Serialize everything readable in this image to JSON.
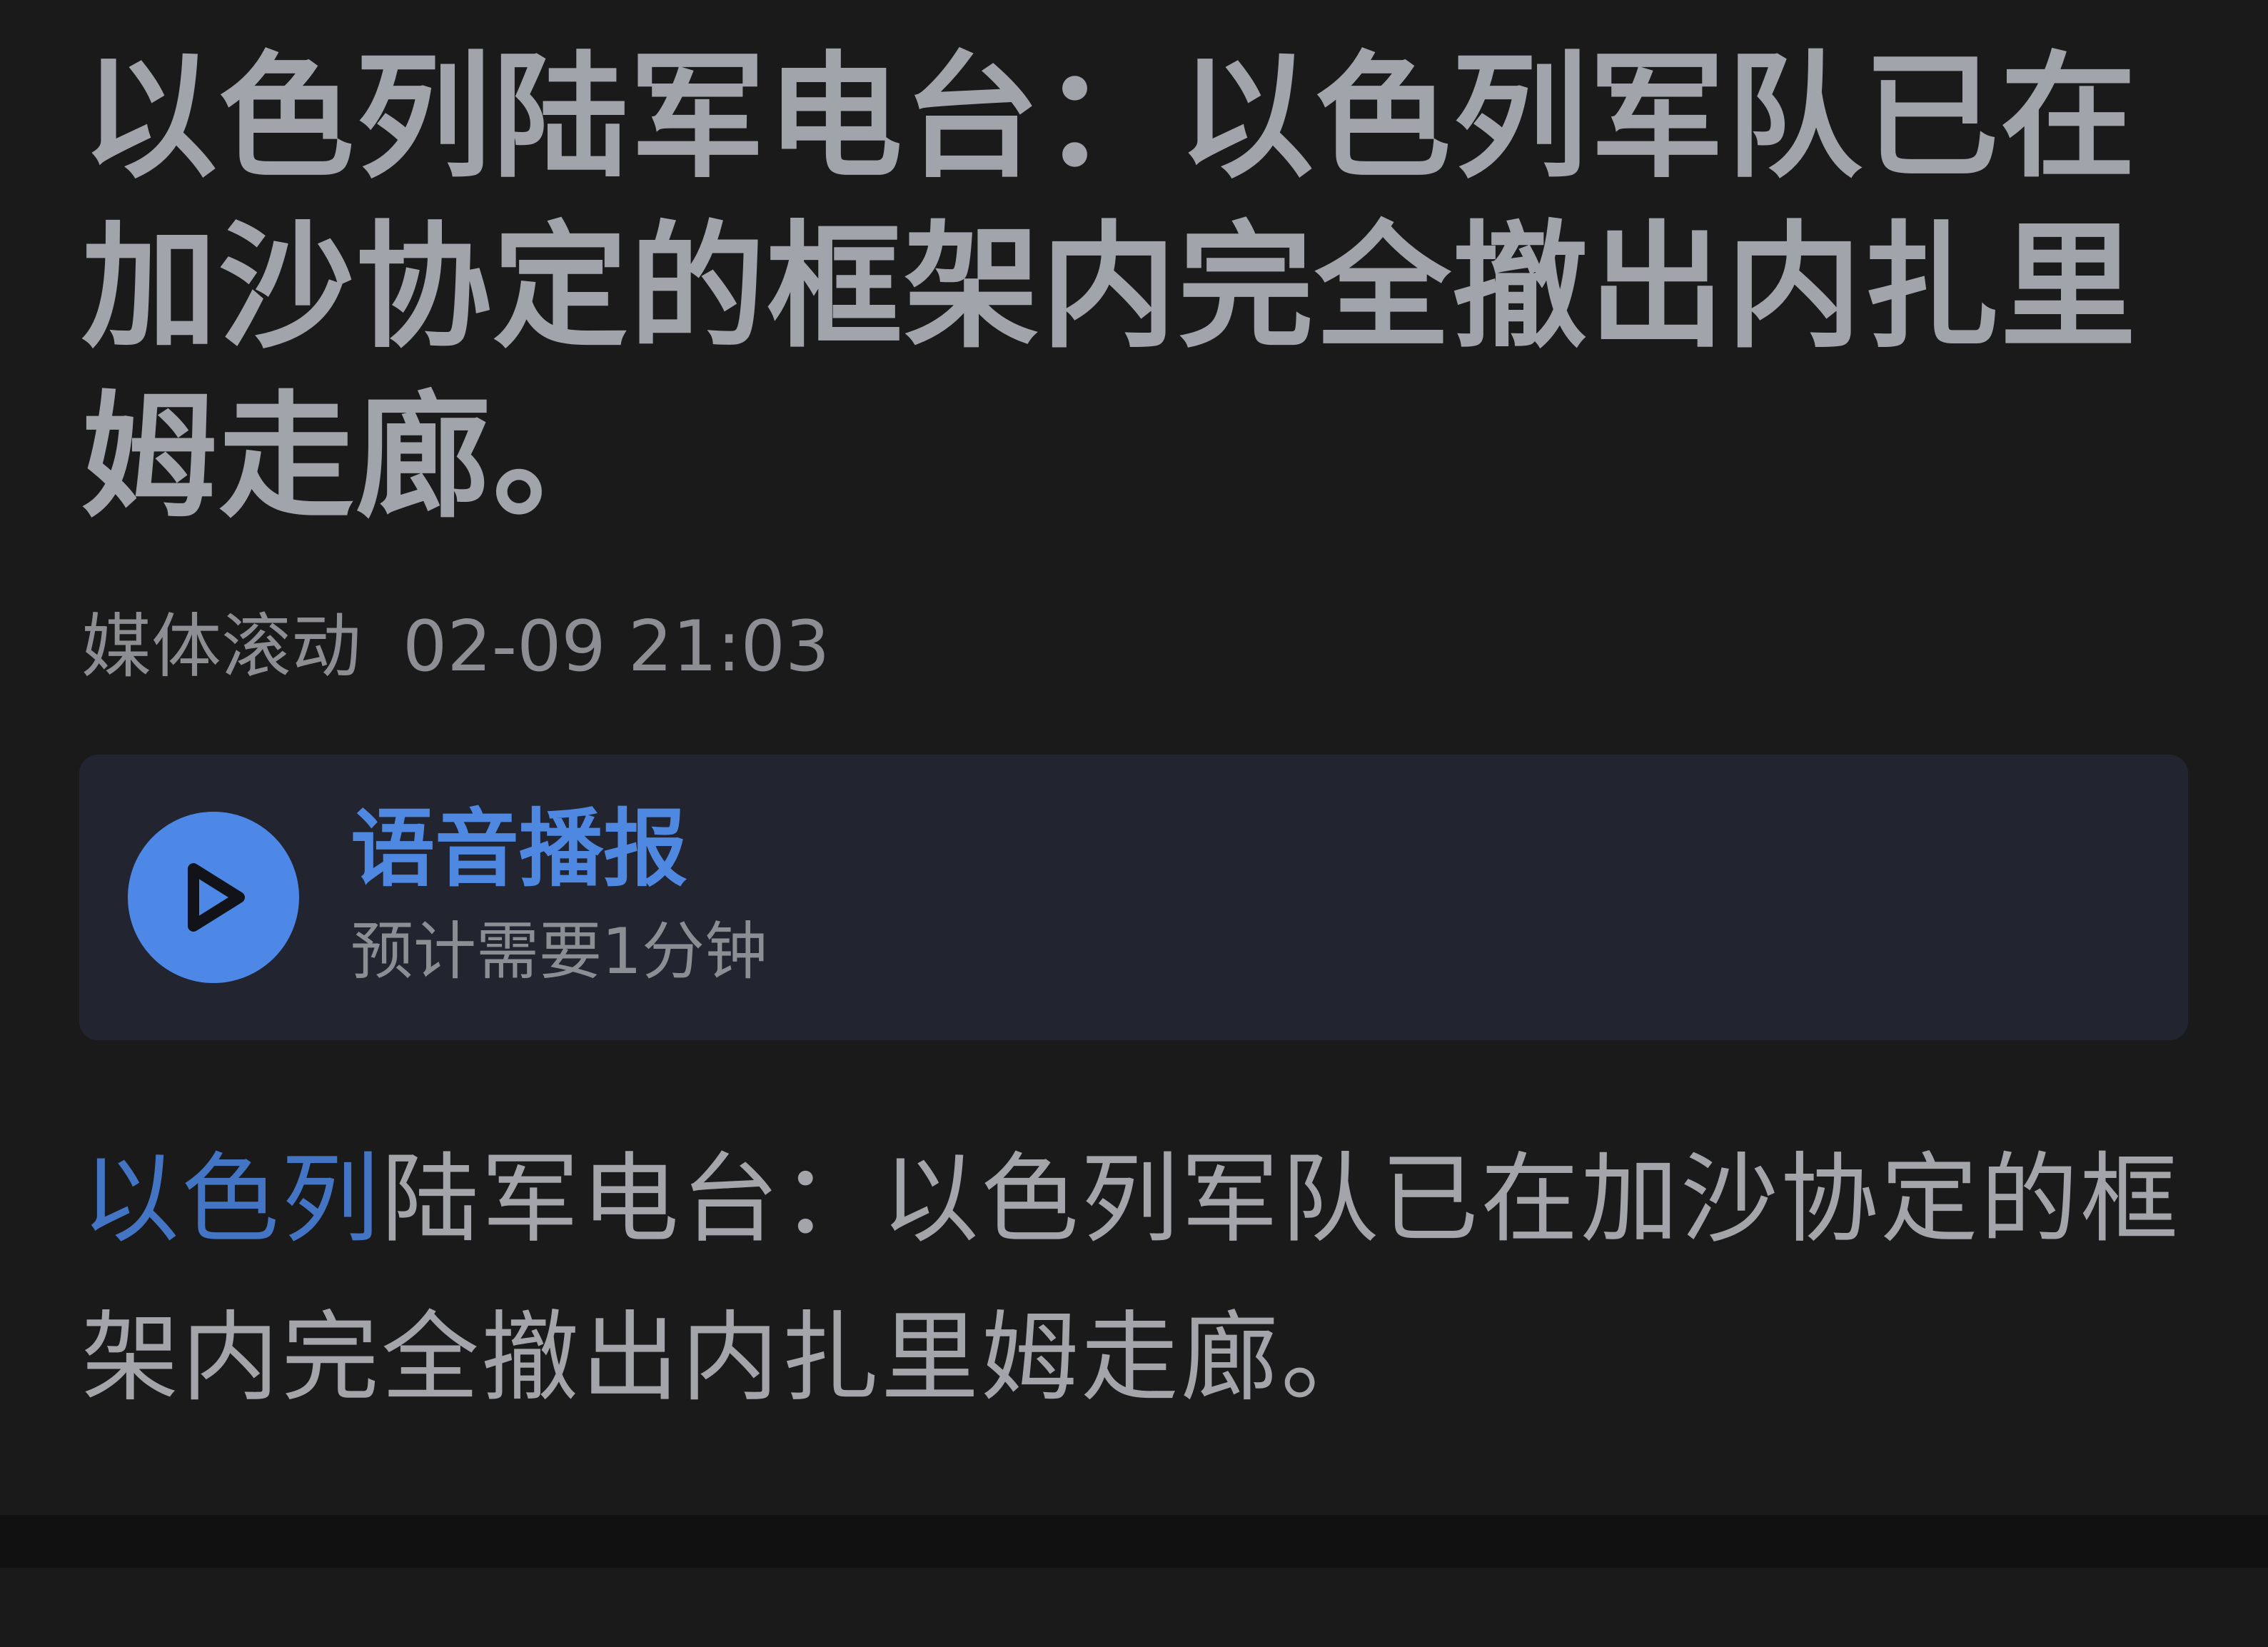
{
  "article": {
    "headline": "以色列陆军电台：以色列军队已在加沙协定的框架内完全撤出内扎里姆走廊。",
    "meta": {
      "source": "媒体滚动",
      "time": "02-09 21:03"
    },
    "audio": {
      "title": "语音播报",
      "duration": "预计需要1分钟",
      "icon": "play-icon"
    },
    "body": {
      "link_text": "以色列",
      "rest_text": "陆军电台：以色列军队已在加沙协定的框架内完全撤出内扎里姆走廊。"
    }
  },
  "colors": {
    "background": "#1a1a1b",
    "headline": "#a2a4ab",
    "meta": "#8c8e94",
    "card_bg": "#222430",
    "accent": "#4d88e7",
    "link": "#4474c4",
    "body": "#a3a5ab"
  }
}
